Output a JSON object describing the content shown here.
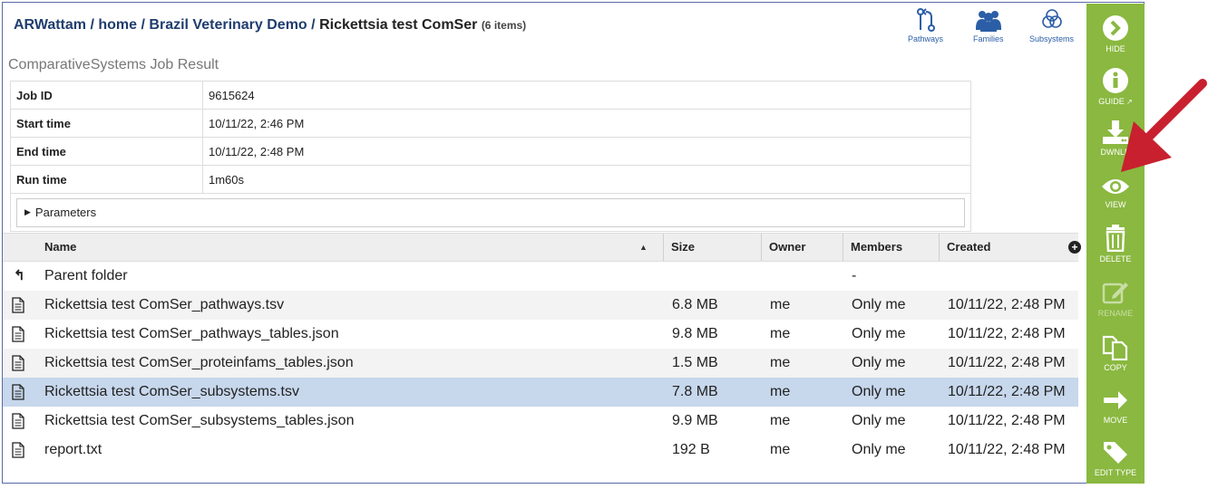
{
  "breadcrumb": {
    "items": [
      "ARWattam",
      "home",
      "Brazil Veterinary Demo"
    ],
    "sep": "/",
    "current": "Rickettsia test ComSer",
    "count": "(6 items)"
  },
  "top_tools": [
    {
      "label": "Pathways",
      "icon": "pathways-icon"
    },
    {
      "label": "Families",
      "icon": "families-icon"
    },
    {
      "label": "Subsystems",
      "icon": "subsystems-icon"
    }
  ],
  "job": {
    "title": "ComparativeSystems Job Result",
    "rows": [
      {
        "key": "Job ID",
        "value": "9615624"
      },
      {
        "key": "Start time",
        "value": "10/11/22, 2:46 PM"
      },
      {
        "key": "End time",
        "value": "10/11/22, 2:48 PM"
      },
      {
        "key": "Run time",
        "value": "1m60s"
      }
    ],
    "parameters_label": "Parameters"
  },
  "grid": {
    "columns": [
      "Name",
      "Size",
      "Owner",
      "Members",
      "Created"
    ],
    "sort_indicator": "▲",
    "parent": {
      "name": "Parent folder",
      "members": "-"
    },
    "files": [
      {
        "name": "Rickettsia test ComSer_pathways.tsv",
        "size": "6.8 MB",
        "owner": "me",
        "members": "Only me",
        "created": "10/11/22, 2:48 PM"
      },
      {
        "name": "Rickettsia test ComSer_pathways_tables.json",
        "size": "9.8 MB",
        "owner": "me",
        "members": "Only me",
        "created": "10/11/22, 2:48 PM"
      },
      {
        "name": "Rickettsia test ComSer_proteinfams_tables.json",
        "size": "1.5 MB",
        "owner": "me",
        "members": "Only me",
        "created": "10/11/22, 2:48 PM"
      },
      {
        "name": "Rickettsia test ComSer_subsystems.tsv",
        "size": "7.8 MB",
        "owner": "me",
        "members": "Only me",
        "created": "10/11/22, 2:48 PM"
      },
      {
        "name": "Rickettsia test ComSer_subsystems_tables.json",
        "size": "9.9 MB",
        "owner": "me",
        "members": "Only me",
        "created": "10/11/22, 2:48 PM"
      },
      {
        "name": "report.txt",
        "size": "192 B",
        "owner": "me",
        "members": "Only me",
        "created": "10/11/22, 2:48 PM"
      }
    ],
    "selected_index": 3
  },
  "sidebar": {
    "buttons": [
      {
        "label": "HIDE",
        "icon": "chevron-right-circle-icon"
      },
      {
        "label": "GUIDE",
        "icon": "info-circle-icon"
      },
      {
        "label": "DWNLD",
        "icon": "download-icon"
      },
      {
        "label": "VIEW",
        "icon": "eye-icon"
      },
      {
        "label": "DELETE",
        "icon": "trash-icon"
      },
      {
        "label": "RENAME",
        "icon": "edit-icon"
      },
      {
        "label": "COPY",
        "icon": "copy-icon"
      },
      {
        "label": "MOVE",
        "icon": "arrow-right-icon"
      },
      {
        "label": "EDIT TYPE",
        "icon": "tag-icon"
      }
    ]
  },
  "colors": {
    "sidebar": "#8ab840",
    "selected_row": "#c7d7ec",
    "breadcrumb": "#1f3d6e",
    "annotation_arrow": "#c8202f"
  }
}
